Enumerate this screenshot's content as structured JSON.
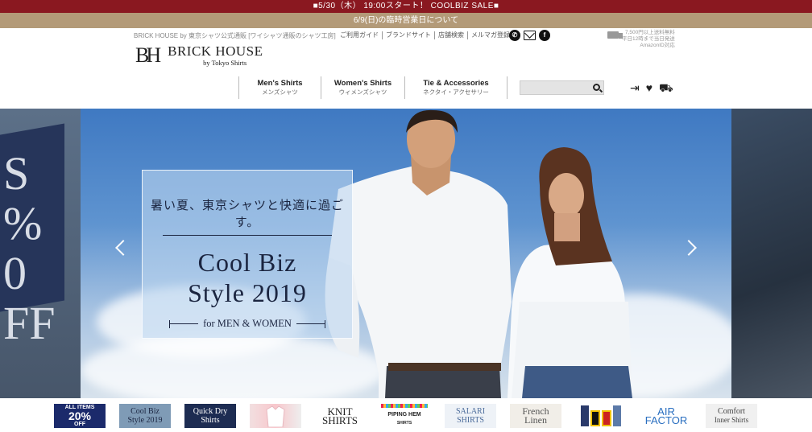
{
  "announcement": {
    "sale": "■5/30（木） 19:00スタート！ COOLBIZ SALE■",
    "notice": "6/9(日)の臨時営業日について"
  },
  "utility": {
    "tagline": "BRICK HOUSE by 東京シャツ公式通販 [ワイシャツ通販のシャツ工房]",
    "links": [
      "ご利用ガイド",
      "ブランドサイト",
      "店舗検索",
      "メルマガ登録"
    ],
    "shipping": [
      "7,500円以上送料無料",
      "平日12時まで当日発送",
      "AmazonID対応"
    ]
  },
  "brand": {
    "mark": "BH",
    "name": "BRICK HOUSE",
    "sub": "by Tokyo Shirts"
  },
  "nav": [
    {
      "en": "Men's Shirts",
      "jp": "メンズシャツ"
    },
    {
      "en": "Women's Shirts",
      "jp": "ウィメンズシャツ"
    },
    {
      "en": "Tie & Accessories",
      "jp": "ネクタイ・アクセサリー"
    }
  ],
  "search": {
    "placeholder": ""
  },
  "hero": {
    "subtitle": "暑い夏、東京シャツと快適に過ごす。",
    "title_line1": "Cool Biz",
    "title_line2": "Style 2019",
    "tag": "for MEN & WOMEN",
    "side_left_text": "S\n%\n0\nFF"
  },
  "thumbnails": [
    {
      "line1": "ALL ITEMS",
      "line2": "20%",
      "line3": "OFF"
    },
    {
      "line1": "Cool Biz",
      "line2": "Style 2019"
    },
    {
      "line1": "Quick Dry",
      "line2": "Shirts"
    },
    {
      "line1": ""
    },
    {
      "line1": "KNIT",
      "line2": "SHIRTS"
    },
    {
      "line1": "PIPING HEM",
      "line2": "SHIRTS"
    },
    {
      "line1": "SALARI",
      "line2": "SHIRTS"
    },
    {
      "line1": "French",
      "line2": "Linen"
    },
    {
      "line1": ""
    },
    {
      "line1": "AIR",
      "line2": "FACTOR"
    },
    {
      "line1": "Comfort",
      "line2": "Inner Shirts"
    }
  ],
  "colors": {
    "sale_bar": "#8a1820",
    "notice_bar": "#b39a78",
    "accent_navy": "#1b2540"
  },
  "icons": [
    "phone-icon",
    "mail-icon",
    "facebook-icon",
    "truck-icon",
    "login-icon",
    "heart-icon",
    "cart-icon",
    "search-icon",
    "chevron-left-icon",
    "chevron-right-icon"
  ]
}
